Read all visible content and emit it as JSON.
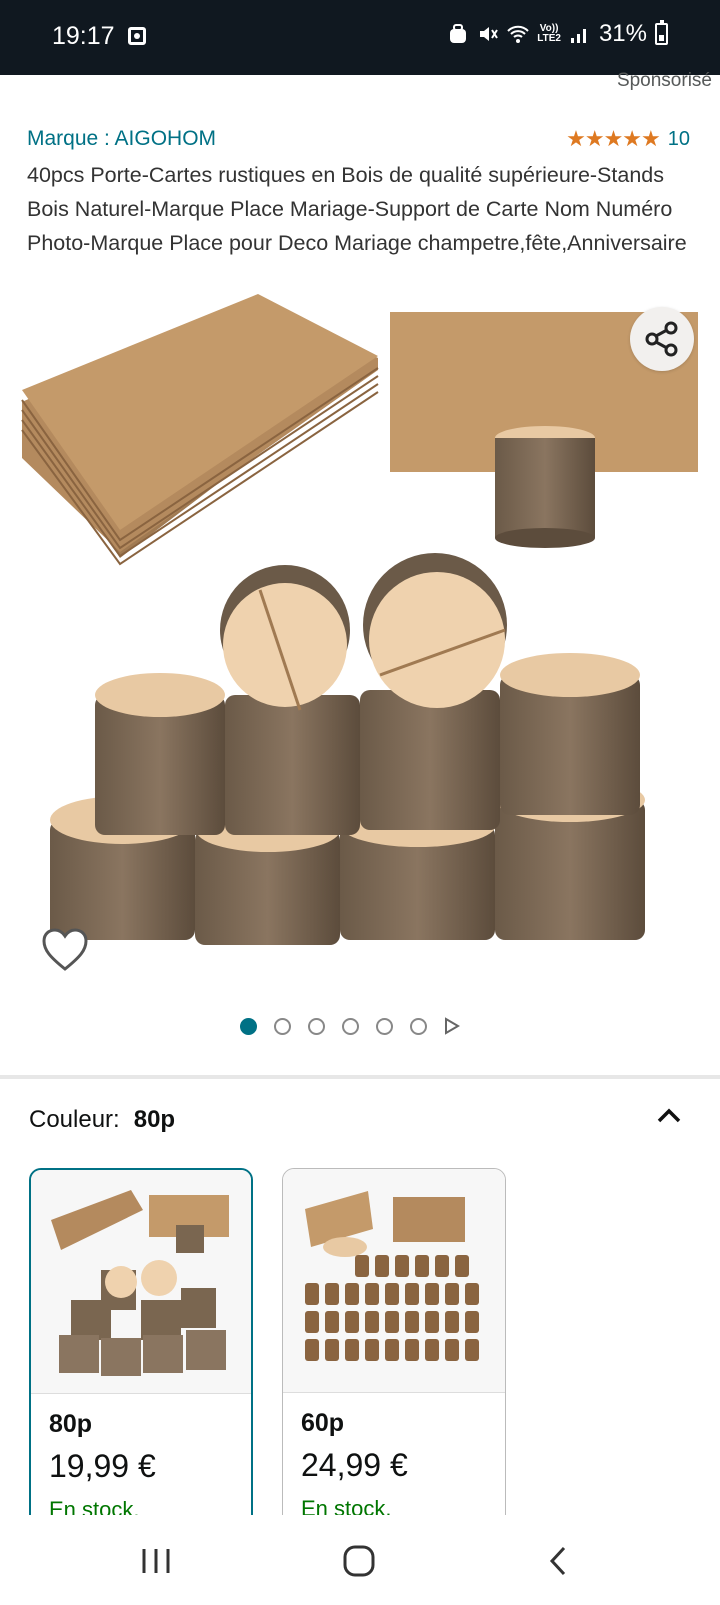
{
  "status_bar": {
    "time": "19:17",
    "volte_top": "Vo))",
    "volte_bottom": "LTE2",
    "battery": "31%"
  },
  "ad": {
    "sponsored": "Sponsorisé"
  },
  "product": {
    "brand": "Marque : AIGOHOM",
    "stars": "★★★★★",
    "rating_count": "10",
    "rating_value": 5,
    "title": "40pcs Porte-Cartes rustiques en Bois de qualité supérieure-Stands Bois Naturel-Marque Place Mariage-Support de Carte Nom Numéro Photo-Marque Place pour Deco Mariage champetre,fête,Anniversaire"
  },
  "gallery": {
    "total_images": 6,
    "active_index": 0
  },
  "variant": {
    "label": "Couleur:",
    "selected": "80p",
    "options": [
      {
        "name": "80p",
        "price": "19,99 €",
        "stock": "En stock.",
        "selected": true
      },
      {
        "name": "60p",
        "price": "24,99 €",
        "stock": "En stock.",
        "selected": false
      }
    ]
  },
  "colors": {
    "accent": "#007185",
    "star": "#de7921",
    "stock": "#007600",
    "statusbar": "#101820"
  }
}
